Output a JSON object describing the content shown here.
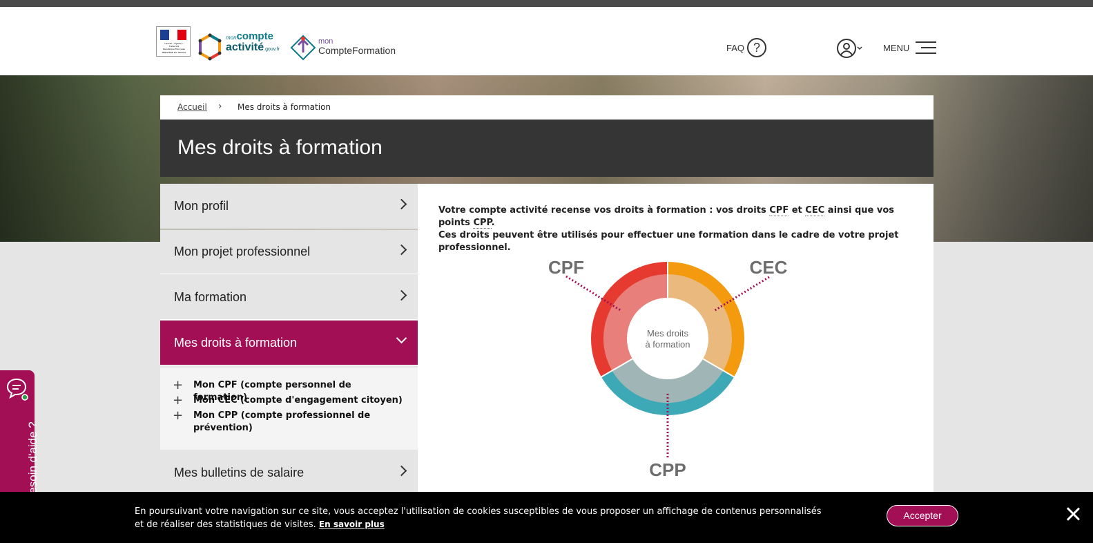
{
  "header": {
    "marianne_lines": [
      "Liberté • Égalité • Fraternité",
      "République Française"
    ],
    "marianne_ministry": "MINISTÈRE DU TRAVAIL",
    "mca_logo": {
      "mon": "mon",
      "compte": "compte",
      "activite": "activité",
      "domain": ".gouv.fr"
    },
    "mcf_logo": {
      "mon": "mon",
      "name": "CompteFormation"
    },
    "faq_label": "FAQ",
    "faq_icon_glyph": "?",
    "menu_label": "MENU"
  },
  "breadcrumb": {
    "home": "Accueil",
    "separator": "›",
    "current": "Mes droits à formation"
  },
  "page_title": "Mes droits à formation",
  "sidebar": {
    "items": [
      {
        "label": "Mon profil"
      },
      {
        "label": "Mon projet professionnel"
      },
      {
        "label": "Ma formation"
      },
      {
        "label": "Mes droits à formation",
        "active": true
      },
      {
        "label": "Mes bulletins de salaire"
      }
    ],
    "sub_items": [
      {
        "label": "Mon CPF (compte personnel de formation)"
      },
      {
        "label": "Mon CEC (compte d'engagement citoyen)"
      },
      {
        "label": "Mon CPP (compte professionnel de prévention)"
      }
    ],
    "plus_glyph": "+"
  },
  "content": {
    "intro_part1": "Votre compte activité recense vos droits à formation : vos droits",
    "abbr_cpf": "CPF",
    "word_and": "et",
    "abbr_cec": "CEC",
    "intro_part2": "ainsi que vos points",
    "abbr_cpp": "CPP",
    "intro_end": ".",
    "intro_line2": "Ces droits peuvent être utilisés pour effectuer une formation dans le cadre de votre projet professionnel.",
    "donut": {
      "center_line1": "Mes droits",
      "center_line2": "à formation",
      "label_cpf": "CPF",
      "label_cec": "CEC",
      "label_cpp": "CPP",
      "colors": {
        "cpf_outer": "#e63930",
        "cpf_inner": "#e97f7b",
        "cec_outer": "#f39a0f",
        "cec_inner": "#e9b97d",
        "cpp_outer": "#3ea9b6",
        "cpp_inner": "#a0b5b5",
        "leader": "#a30f55"
      }
    }
  },
  "help_tab": {
    "label": "Besoin d'aide ?"
  },
  "cookie": {
    "message": "En poursuivant votre navigation sur ce site, vous acceptez l'utilisation de cookies susceptibles de vous proposer un affichage de contenus personnalisés et de réaliser des statistiques de visites.",
    "more_link": "En savoir plus",
    "accept": "Accepter"
  },
  "colors": {
    "brand": "#a30f55",
    "title_band": "#353535",
    "cookie_bg": "#000000"
  }
}
